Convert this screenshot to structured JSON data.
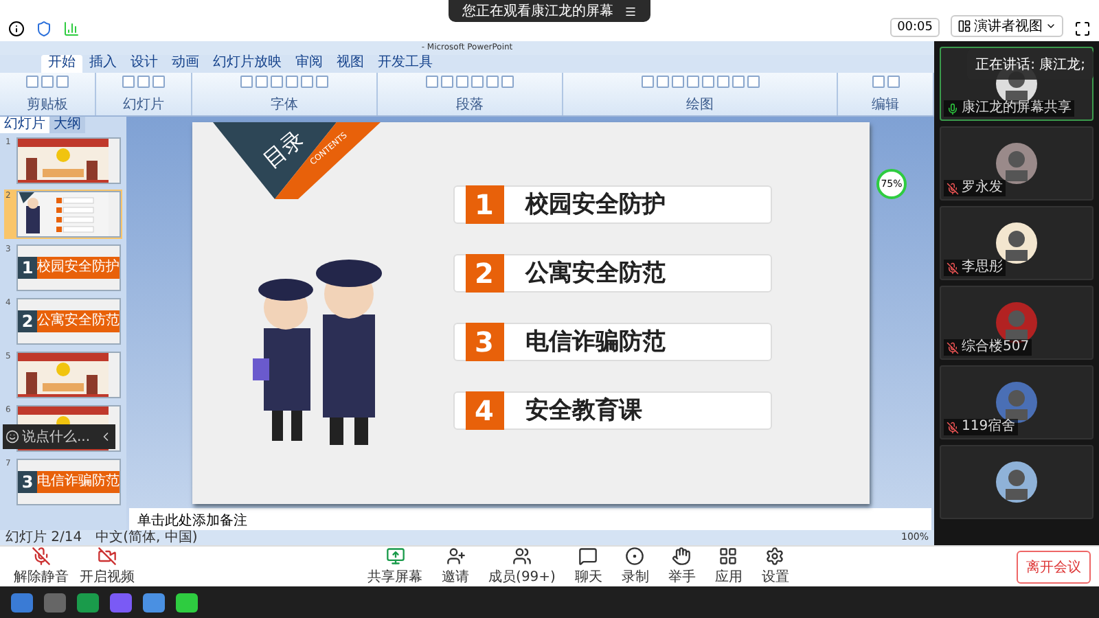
{
  "notice": {
    "text": "您正在观看康江龙的屏幕"
  },
  "top_bar": {
    "timer": "00:05",
    "view_button": "演讲者视图"
  },
  "powerpoint": {
    "title": "- Microsoft PowerPoint",
    "tabs": [
      {
        "label": "开始",
        "selected": true
      },
      {
        "label": "插入",
        "selected": false
      },
      {
        "label": "设计",
        "selected": false
      },
      {
        "label": "动画",
        "selected": false
      },
      {
        "label": "幻灯片放映",
        "selected": false
      },
      {
        "label": "审阅",
        "selected": false
      },
      {
        "label": "视图",
        "selected": false
      },
      {
        "label": "开发工具",
        "selected": false
      }
    ],
    "groups": [
      "剪贴板",
      "幻灯片",
      "字体",
      "段落",
      "绘图",
      "编辑"
    ],
    "pane_tabs": [
      {
        "label": "幻灯片",
        "selected": true
      },
      {
        "label": "大纲",
        "selected": false
      }
    ],
    "thumbnails": [
      {
        "number": "1",
        "kind": "picture",
        "selected": false
      },
      {
        "number": "2",
        "kind": "contents",
        "selected": true
      },
      {
        "number": "3",
        "kind": "section",
        "index": "1",
        "title": "校园安全防护",
        "selected": false
      },
      {
        "number": "4",
        "kind": "section",
        "index": "2",
        "title": "公寓安全防范",
        "selected": false
      },
      {
        "number": "5",
        "kind": "picture",
        "selected": false
      },
      {
        "number": "6",
        "kind": "picture",
        "selected": false
      },
      {
        "number": "7",
        "kind": "section",
        "index": "3",
        "title": "电信诈骗防范",
        "selected": false
      }
    ],
    "chat_input": {
      "placeholder": "说点什么..."
    },
    "slide": {
      "heading": "目录",
      "subheading": "CONTENTS",
      "items": [
        {
          "number": "1",
          "label": "校园安全防护"
        },
        {
          "number": "2",
          "label": "公寓安全防范"
        },
        {
          "number": "3",
          "label": "电信诈骗防范"
        },
        {
          "number": "4",
          "label": "安全教育课"
        }
      ]
    },
    "network_badge": "75%",
    "notes_placeholder": "单击此处添加备注",
    "status": [
      "幻灯片 2/14",
      "中文(简体, 中国)"
    ],
    "zoom": "100%"
  },
  "speaking": "正在讲话: 康江龙;",
  "participants": [
    {
      "name": "康江龙的屏幕共享",
      "muted": false,
      "active": true
    },
    {
      "name": "罗永发",
      "muted": true,
      "active": false
    },
    {
      "name": "李思彤",
      "muted": true,
      "active": false
    },
    {
      "name": "综合楼507",
      "muted": true,
      "active": false
    },
    {
      "name": "119宿舍",
      "muted": true,
      "active": false
    },
    {
      "active": false
    }
  ],
  "toolbar": {
    "left": [
      {
        "label": "解除静音",
        "kind": "mic"
      },
      {
        "label": "开启视频",
        "kind": "video"
      }
    ],
    "center": [
      {
        "label": "共享屏幕",
        "kind": "share"
      },
      {
        "label": "邀请",
        "kind": "invite"
      },
      {
        "label": "成员(99+)",
        "kind": "members"
      },
      {
        "label": "聊天",
        "kind": "chat"
      },
      {
        "label": "录制",
        "kind": "record"
      },
      {
        "label": "举手",
        "kind": "hand"
      },
      {
        "label": "应用",
        "kind": "apps"
      },
      {
        "label": "设置",
        "kind": "settings"
      }
    ],
    "leave": "离开会议"
  }
}
